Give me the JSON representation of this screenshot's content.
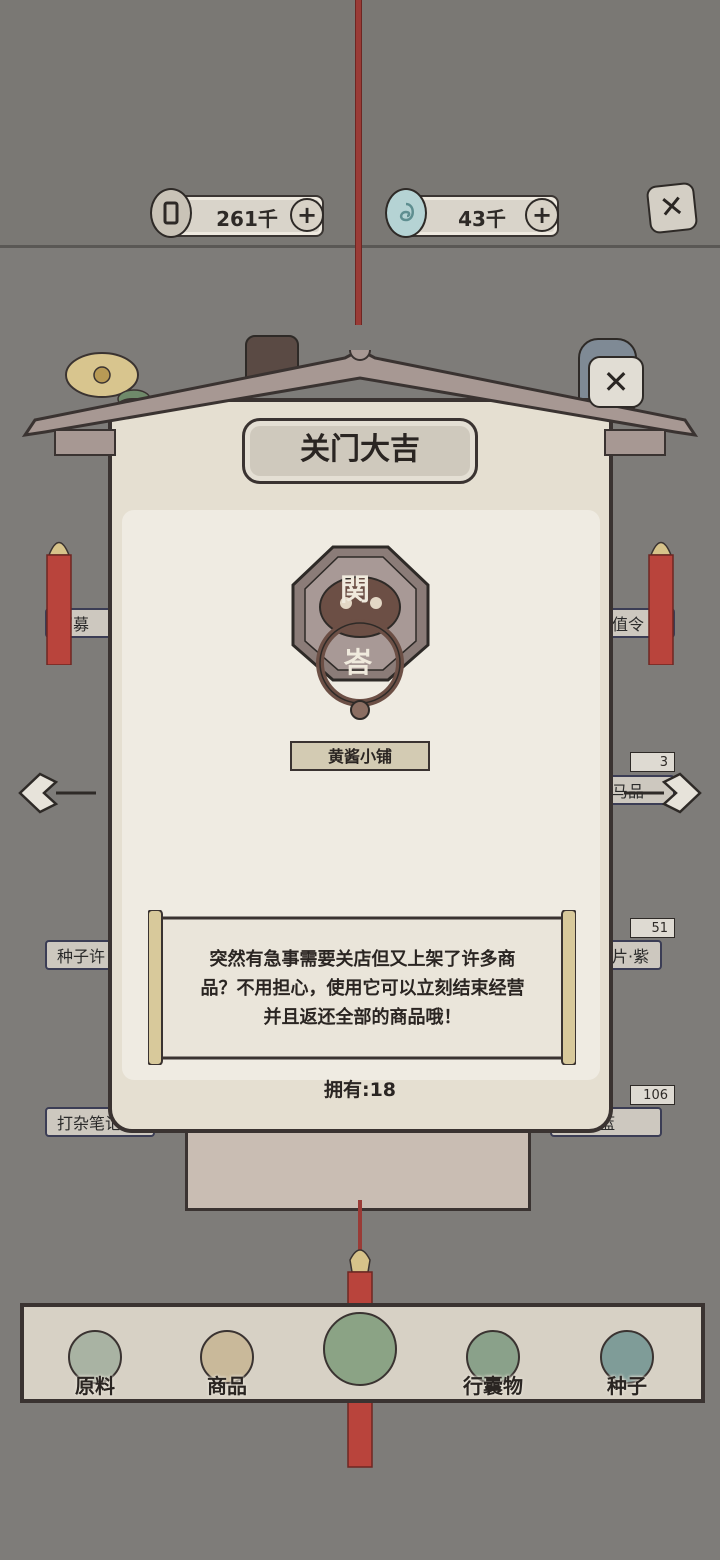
{
  "currencies": [
    {
      "name": "coin",
      "value": "261千",
      "plus": "+"
    },
    {
      "name": "jade",
      "value": "43千",
      "plus": "+"
    }
  ],
  "top_close": "✕",
  "panel": {
    "title": "关门大吉",
    "close": "✕",
    "item_emblem_top": "関",
    "item_emblem_bottom": "峇",
    "shop_name": "黄酱小铺",
    "description_lines": [
      "突然有急事需要关店但又上架了许多商",
      "品？不用担心，使用它可以立刻结束经营",
      "并且返还全部的商品哦！"
    ],
    "owned": "拥有:18"
  },
  "side_left": [
    "招募",
    "种子许",
    "打杂笔记"
  ],
  "side_right": [
    "值令",
    "马品",
    "片·紫",
    "碎片·蓝"
  ],
  "side_counts": [
    "3",
    "51",
    "106"
  ],
  "nav": [
    {
      "label": "原料",
      "icon": "leaf-icon"
    },
    {
      "label": "商品",
      "icon": "goods-icon"
    },
    {
      "label": "",
      "icon": "tea-icon"
    },
    {
      "label": "行囊物",
      "icon": "clothes-icon"
    },
    {
      "label": "种子",
      "icon": "seed-bag-icon"
    }
  ],
  "colors": {
    "cord": "#9a3b36",
    "panel": "#e5dfd1",
    "background": "#7e7c79"
  }
}
